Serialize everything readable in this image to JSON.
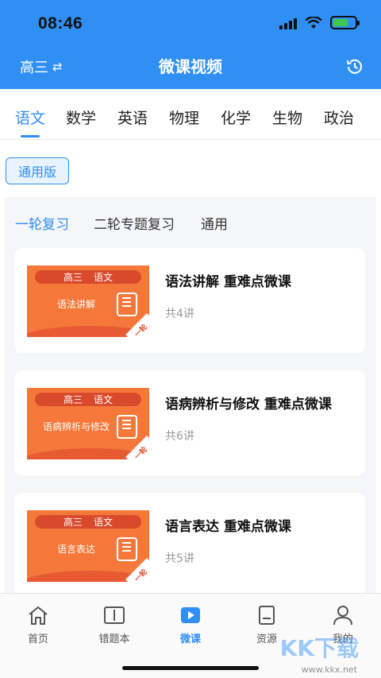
{
  "status_bar": {
    "time": "08:46"
  },
  "header": {
    "grade": "高三",
    "grade_switch_icon": "swap-icon",
    "title": "微课视频",
    "history_icon": "clock-history-icon"
  },
  "subjects": [
    {
      "label": "语文",
      "active": true
    },
    {
      "label": "数学"
    },
    {
      "label": "英语"
    },
    {
      "label": "物理"
    },
    {
      "label": "化学"
    },
    {
      "label": "生物"
    },
    {
      "label": "政治"
    }
  ],
  "version": "通用版",
  "review_tabs": [
    {
      "label": "一轮复习",
      "active": true
    },
    {
      "label": "二轮专题复习"
    },
    {
      "label": "通用"
    }
  ],
  "courses": [
    {
      "thumb_grade": "高三",
      "thumb_subject": "语文",
      "thumb_topic": "语法讲解",
      "corner": "一轮",
      "title": "语法讲解 重难点微课",
      "count": "共4讲"
    },
    {
      "thumb_grade": "高三",
      "thumb_subject": "语文",
      "thumb_topic": "语病辨析与修改",
      "corner": "一轮",
      "title": "语病辨析与修改 重难点微课",
      "count": "共6讲"
    },
    {
      "thumb_grade": "高三",
      "thumb_subject": "语文",
      "thumb_topic": "语言表达",
      "corner": "一轮",
      "title": "语言表达 重难点微课",
      "count": "共5讲"
    }
  ],
  "bottom_nav": [
    {
      "label": "首页",
      "icon": "home-icon"
    },
    {
      "label": "错题本",
      "icon": "book-icon"
    },
    {
      "label": "微课",
      "icon": "play-icon",
      "active": true
    },
    {
      "label": "资源",
      "icon": "document-icon"
    },
    {
      "label": "我的",
      "icon": "user-icon"
    }
  ],
  "watermark": {
    "text": "KK下载",
    "url": "www.kkx.net"
  },
  "colors": {
    "primary": "#2f8ff3",
    "thumb_orange": "#f5783a",
    "thumb_red": "#d94a2c"
  }
}
